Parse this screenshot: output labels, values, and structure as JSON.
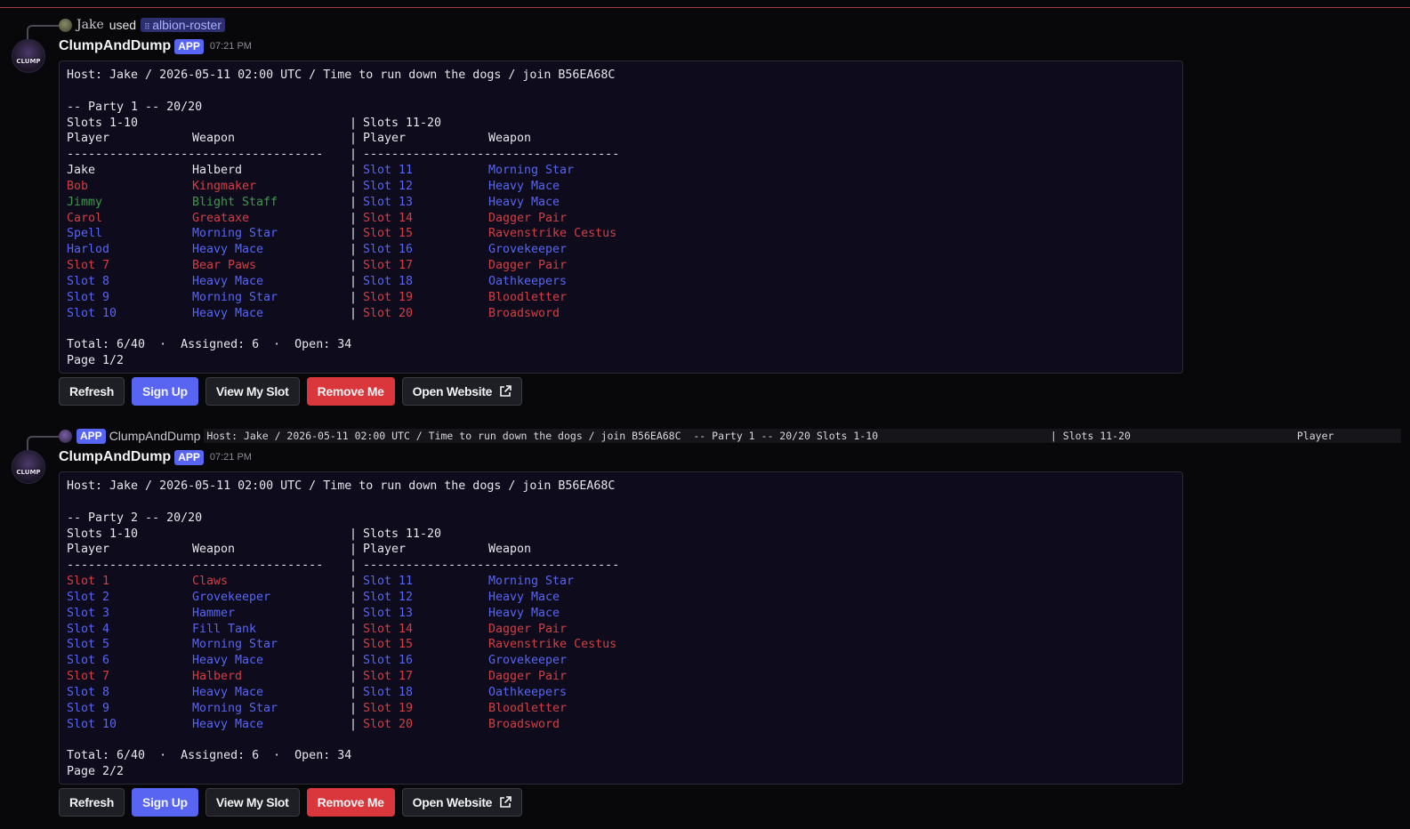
{
  "message1": {
    "reply": {
      "user": "Jake",
      "used": "used",
      "command_icon": "command-icon",
      "command": "albion-roster"
    },
    "author": "ClumpAndDump",
    "app_badge": "APP",
    "timestamp": "07:21 PM",
    "avatar_text": "CLUMP",
    "content": {
      "host_line": "Host: Jake / 2026-05-11 02:00 UTC / Time to run down the dogs / join B56EA68C",
      "party_line": "-- Party 1 -- 20/20",
      "left_section": "Slots 1-10",
      "right_section": "Slots 11-20",
      "col_player": "Player",
      "col_weapon": "Weapon",
      "divider": "------------------------------------",
      "rows": [
        {
          "lname": "Jake",
          "lweapon": "Halberd",
          "lcolor": "white",
          "rname": "Slot 11",
          "rweapon": "Morning Star",
          "rcolor": "blue"
        },
        {
          "lname": "Bob",
          "lweapon": "Kingmaker",
          "lcolor": "red",
          "rname": "Slot 12",
          "rweapon": "Heavy Mace",
          "rcolor": "blue"
        },
        {
          "lname": "Jimmy",
          "lweapon": "Blight Staff",
          "lcolor": "green",
          "rname": "Slot 13",
          "rweapon": "Heavy Mace",
          "rcolor": "blue"
        },
        {
          "lname": "Carol",
          "lweapon": "Greataxe",
          "lcolor": "red",
          "rname": "Slot 14",
          "rweapon": "Dagger Pair",
          "rcolor": "red"
        },
        {
          "lname": "Spell",
          "lweapon": "Morning Star",
          "lcolor": "blue",
          "rname": "Slot 15",
          "rweapon": "Ravenstrike Cestus",
          "rcolor": "red"
        },
        {
          "lname": "Harlod",
          "lweapon": "Heavy Mace",
          "lcolor": "blue",
          "rname": "Slot 16",
          "rweapon": "Grovekeeper",
          "rcolor": "blue"
        },
        {
          "lname": "Slot 7",
          "lweapon": "Bear Paws",
          "lcolor": "red",
          "rname": "Slot 17",
          "rweapon": "Dagger Pair",
          "rcolor": "red"
        },
        {
          "lname": "Slot 8",
          "lweapon": "Heavy Mace",
          "lcolor": "blue",
          "rname": "Slot 18",
          "rweapon": "Oathkeepers",
          "rcolor": "blue"
        },
        {
          "lname": "Slot 9",
          "lweapon": "Morning Star",
          "lcolor": "blue",
          "rname": "Slot 19",
          "rweapon": "Bloodletter",
          "rcolor": "red"
        },
        {
          "lname": "Slot 10",
          "lweapon": "Heavy Mace",
          "lcolor": "blue",
          "rname": "Slot 20",
          "rweapon": "Broadsword",
          "rcolor": "red"
        }
      ],
      "total_line": "Total: 6/40  ·  Assigned: 6  ·  Open: 34",
      "page_line": "Page 1/2"
    }
  },
  "message2": {
    "reply": {
      "app_badge": "APP",
      "author": "ClumpAndDump",
      "preview": "Host: Jake / 2026-05-11 02:00 UTC / Time to run down the dogs / join B56EA68C  -- Party 1 -- 20/20 Slots 1-10                            | Slots 11-20                           Player"
    },
    "author": "ClumpAndDump",
    "app_badge": "APP",
    "timestamp": "07:21 PM",
    "avatar_text": "CLUMP",
    "content": {
      "host_line": "Host: Jake / 2026-05-11 02:00 UTC / Time to run down the dogs / join B56EA68C",
      "party_line": "-- Party 2 -- 20/20",
      "left_section": "Slots 1-10",
      "right_section": "Slots 11-20",
      "col_player": "Player",
      "col_weapon": "Weapon",
      "divider": "------------------------------------",
      "rows": [
        {
          "lname": "Slot 1",
          "lweapon": "Claws",
          "lcolor": "red",
          "rname": "Slot 11",
          "rweapon": "Morning Star",
          "rcolor": "blue"
        },
        {
          "lname": "Slot 2",
          "lweapon": "Grovekeeper",
          "lcolor": "blue",
          "rname": "Slot 12",
          "rweapon": "Heavy Mace",
          "rcolor": "blue"
        },
        {
          "lname": "Slot 3",
          "lweapon": "Hammer",
          "lcolor": "blue",
          "rname": "Slot 13",
          "rweapon": "Heavy Mace",
          "rcolor": "blue"
        },
        {
          "lname": "Slot 4",
          "lweapon": "Fill Tank",
          "lcolor": "blue",
          "rname": "Slot 14",
          "rweapon": "Dagger Pair",
          "rcolor": "red"
        },
        {
          "lname": "Slot 5",
          "lweapon": "Morning Star",
          "lcolor": "blue",
          "rname": "Slot 15",
          "rweapon": "Ravenstrike Cestus",
          "rcolor": "red"
        },
        {
          "lname": "Slot 6",
          "lweapon": "Heavy Mace",
          "lcolor": "blue",
          "rname": "Slot 16",
          "rweapon": "Grovekeeper",
          "rcolor": "blue"
        },
        {
          "lname": "Slot 7",
          "lweapon": "Halberd",
          "lcolor": "red",
          "rname": "Slot 17",
          "rweapon": "Dagger Pair",
          "rcolor": "red"
        },
        {
          "lname": "Slot 8",
          "lweapon": "Heavy Mace",
          "lcolor": "blue",
          "rname": "Slot 18",
          "rweapon": "Oathkeepers",
          "rcolor": "blue"
        },
        {
          "lname": "Slot 9",
          "lweapon": "Morning Star",
          "lcolor": "blue",
          "rname": "Slot 19",
          "rweapon": "Bloodletter",
          "rcolor": "red"
        },
        {
          "lname": "Slot 10",
          "lweapon": "Heavy Mace",
          "lcolor": "blue",
          "rname": "Slot 20",
          "rweapon": "Broadsword",
          "rcolor": "red"
        }
      ],
      "total_line": "Total: 6/40  ·  Assigned: 6  ·  Open: 34",
      "page_line": "Page 2/2"
    }
  },
  "buttons": {
    "refresh": "Refresh",
    "sign_up": "Sign Up",
    "view_my_slot": "View My Slot",
    "remove_me": "Remove Me",
    "open_website": "Open Website",
    "open_website_icon": "external-link-icon"
  },
  "colors": {
    "red": "#d23f45",
    "blue": "#5865f2",
    "green": "#3c9a4a",
    "white": "#e6e6ea",
    "primary_button": "#5865f2",
    "danger_button": "#da373c",
    "divider_line": "#d4524d"
  }
}
